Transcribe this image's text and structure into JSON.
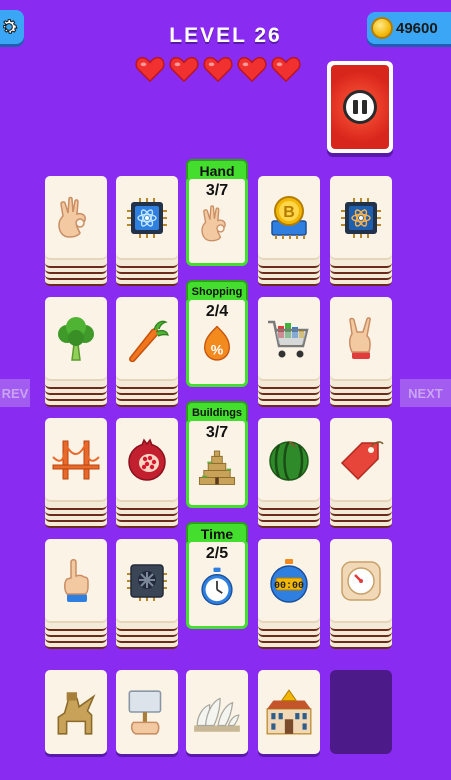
{
  "header": {
    "level_title": "LEVEL 26",
    "coins": "49600",
    "lives": 5
  },
  "colors": {
    "background": "#8a2bf2",
    "category_green": "#44df2e",
    "card_face": "#fbf4e6",
    "heart": "#f0312f",
    "pause_red": "#d9261c",
    "button_blue": "#3aa6f5"
  },
  "nav": {
    "prev_label": "REV",
    "next_label": "NEXT"
  },
  "categories": [
    {
      "label": "Hand",
      "progress": "3/7",
      "icon": "ok-hand-icon"
    },
    {
      "label": "Shopping",
      "progress": "2/4",
      "icon": "discount-tag-icon"
    },
    {
      "label": "Buildings",
      "progress": "3/7",
      "icon": "step-pyramid-icon"
    },
    {
      "label": "Time",
      "progress": "2/5",
      "icon": "stopwatch-icon"
    }
  ],
  "board": [
    [
      "ok-hand-icon",
      "atom-chip-icon",
      "category",
      "bitcoin-chip-icon",
      "atom-chip-icon"
    ],
    [
      "broccoli-icon",
      "carrot-icon",
      "category",
      "shopping-cart-icon",
      "rock-hand-icon"
    ],
    [
      "golden-gate-bridge-icon",
      "pomegranate-icon",
      "category",
      "watermelon-icon",
      "price-tag-icon"
    ],
    [
      "pointing-hand-icon",
      "processor-chip-icon",
      "category",
      "digital-stopwatch-icon",
      "kitchen-timer-icon"
    ]
  ],
  "hand": [
    "lamassu-statue-icon",
    "hand-holding-sign-icon",
    "opera-house-icon",
    "palace-icon",
    "empty-slot"
  ]
}
